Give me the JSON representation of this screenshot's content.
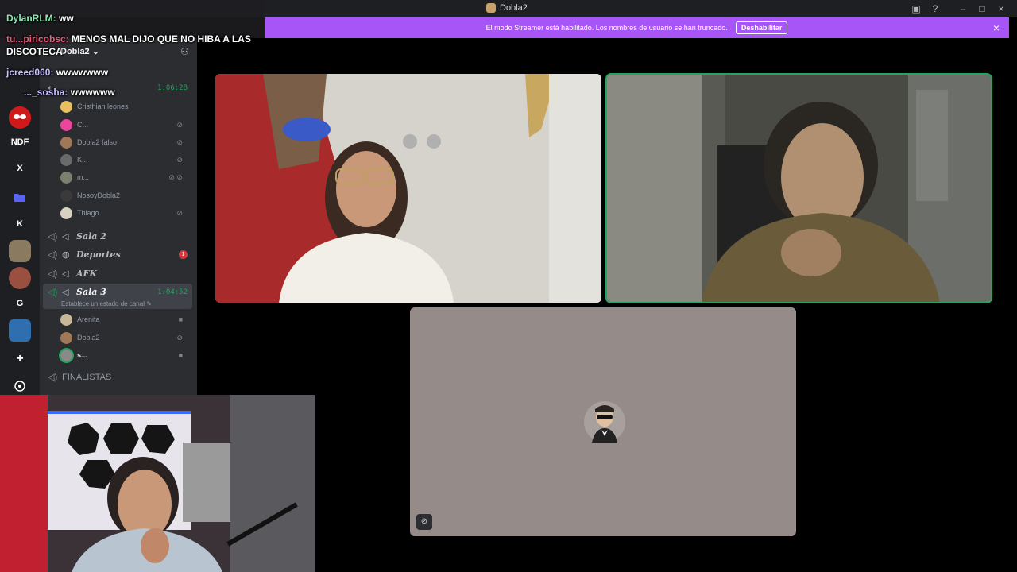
{
  "window": {
    "title": "Dobla2"
  },
  "banner": {
    "message": "El modo Streamer está habilitado. Los nombres de usuario se han truncado.",
    "disable_label": "Deshabilitar"
  },
  "rail": {
    "items": [
      "NDF",
      "X",
      "K",
      "G"
    ]
  },
  "sidebar": {
    "server_name": "Dobla2",
    "channels": {
      "sala1_timer": "1:06:28",
      "sala2": "Sala 2",
      "deportes": "Deportes",
      "deportes_badge": "1",
      "afk": "AFK",
      "sala3": "Sala 3",
      "sala3_timer": "1:04:52",
      "sala3_status": "Establece un estado de canal",
      "finalistas": "FINALISTAS"
    },
    "sala1_users": [
      "Cristhian leones",
      "C...",
      "Dobla2 falso",
      "K...",
      "m...",
      "NosoyDobla2",
      "Thiago"
    ],
    "sala3_users": [
      "Arenita",
      "Dobla2",
      "s..."
    ]
  },
  "chat": {
    "line1_user": "DylanRLM:",
    "line1_msg": "ww",
    "line2_user": "tu...piricobsc:",
    "line2_msg": "MENOS MAL DIJO QUE NO HIBA A LAS",
    "line2_cont": "DISCOTECA",
    "line3_user": "jcreed060:",
    "line3_msg": "wwwwwww",
    "line4_user": "..._sosha:",
    "line4_msg": "wwwwww"
  },
  "colors": {
    "banner": "#a855f7",
    "speaking": "#23a55a",
    "sidebar": "#2b2d31",
    "rail": "#1e1f22"
  }
}
